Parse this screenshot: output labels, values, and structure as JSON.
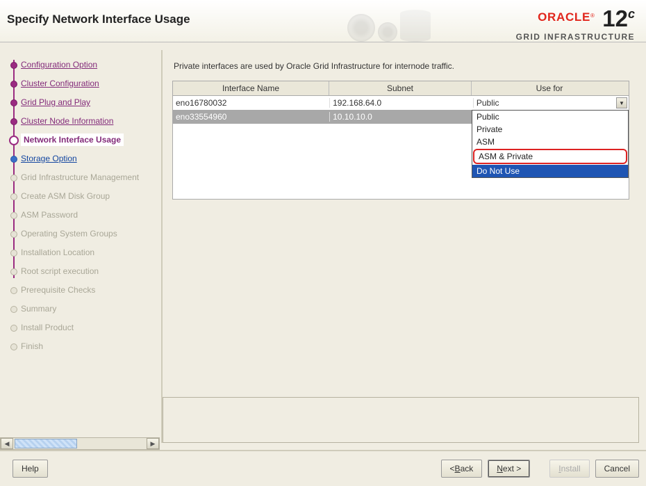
{
  "header": {
    "title": "Specify Network Interface Usage",
    "brand_oracle": "ORACLE",
    "brand_sub": "GRID INFRASTRUCTURE",
    "brand_version_num": "12",
    "brand_version_suffix": "c"
  },
  "nav": {
    "items": [
      {
        "label": "Configuration Option",
        "state": "visited"
      },
      {
        "label": "Cluster Configuration",
        "state": "visited"
      },
      {
        "label": "Grid Plug and Play",
        "state": "visited"
      },
      {
        "label": "Cluster Node Information",
        "state": "visited"
      },
      {
        "label": "Network Interface Usage",
        "state": "current"
      },
      {
        "label": "Storage Option",
        "state": "next"
      },
      {
        "label": "Grid Infrastructure Management",
        "state": "future"
      },
      {
        "label": "Create ASM Disk Group",
        "state": "future"
      },
      {
        "label": "ASM Password",
        "state": "future"
      },
      {
        "label": "Operating System Groups",
        "state": "future"
      },
      {
        "label": "Installation Location",
        "state": "future"
      },
      {
        "label": "Root script execution",
        "state": "future"
      },
      {
        "label": "Prerequisite Checks",
        "state": "future"
      },
      {
        "label": "Summary",
        "state": "future"
      },
      {
        "label": "Install Product",
        "state": "future"
      },
      {
        "label": "Finish",
        "state": "future"
      }
    ]
  },
  "main": {
    "instruction": "Private interfaces are used by Oracle Grid Infrastructure for internode traffic.",
    "columns": {
      "iface": "Interface Name",
      "subnet": "Subnet",
      "usefor": "Use for"
    },
    "rows": [
      {
        "iface": "eno16780032",
        "subnet": "192.168.64.0",
        "usefor": "Public",
        "selected": false
      },
      {
        "iface": "eno33554960",
        "subnet": "10.10.10.0",
        "usefor": "Do Not Use",
        "selected": true
      }
    ],
    "dropdown_options": [
      {
        "label": "Public"
      },
      {
        "label": "Private"
      },
      {
        "label": "ASM"
      },
      {
        "label": "ASM & Private",
        "red_highlight": true
      },
      {
        "label": "Do Not Use",
        "selected": true
      }
    ]
  },
  "footer": {
    "help": "Help",
    "back_prefix": "< ",
    "back_m": "B",
    "back_rest": "ack",
    "next_m": "N",
    "next_rest": "ext >",
    "install_m": "I",
    "install_rest": "nstall",
    "cancel": "Cancel"
  }
}
